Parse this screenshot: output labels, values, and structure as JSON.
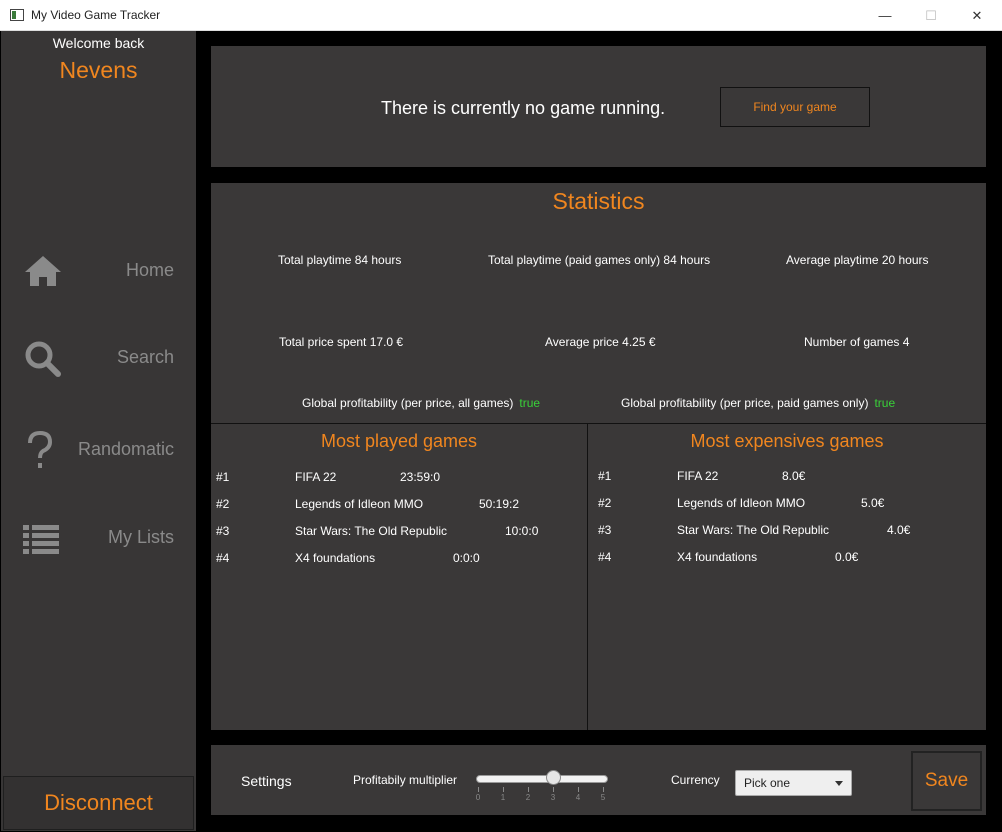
{
  "window": {
    "title": "My Video Game Tracker",
    "minimize_glyph": "—",
    "maximize_glyph": "☐",
    "close_glyph": "✕"
  },
  "sidebar": {
    "welcome": "Welcome back",
    "username": "Nevens",
    "items": [
      {
        "label": "Home",
        "icon": "home-icon"
      },
      {
        "label": "Search",
        "icon": "search-icon"
      },
      {
        "label": "Randomatic",
        "icon": "question-icon"
      },
      {
        "label": "My Lists",
        "icon": "list-icon"
      }
    ],
    "disconnect_label": "Disconnect"
  },
  "running": {
    "message": "There is currently no game running.",
    "find_button": "Find your game"
  },
  "statistics": {
    "title": "Statistics",
    "total_playtime": "Total playtime 84 hours",
    "total_playtime_paid": "Total playtime (paid games only) 84 hours",
    "average_playtime": "Average playtime 20 hours",
    "total_price": "Total price spent 17.0 €",
    "average_price": "Average price 4.25 €",
    "number_of_games": "Number of games 4",
    "global_profit_all_label": "Global profitability (per price, all games)",
    "global_profit_all_value": "true",
    "global_profit_paid_label": "Global profitability (per price, paid games only)",
    "global_profit_paid_value": "true"
  },
  "most_played": {
    "title": "Most played games",
    "rows": [
      {
        "rank": "#1",
        "name": "FIFA 22",
        "value": "23:59:0"
      },
      {
        "rank": "#2",
        "name": "Legends of Idleon MMO",
        "value": "50:19:2"
      },
      {
        "rank": "#3",
        "name": "Star Wars: The Old Republic",
        "value": "10:0:0"
      },
      {
        "rank": "#4",
        "name": "X4 foundations",
        "value": "0:0:0"
      }
    ]
  },
  "most_expensive": {
    "title": "Most expensives games",
    "rows": [
      {
        "rank": "#1",
        "name": "FIFA 22",
        "value": "8.0€"
      },
      {
        "rank": "#2",
        "name": "Legends of Idleon MMO",
        "value": "5.0€"
      },
      {
        "rank": "#3",
        "name": "Star Wars: The Old Republic",
        "value": "4.0€"
      },
      {
        "rank": "#4",
        "name": "X4 foundations",
        "value": "0.0€"
      }
    ]
  },
  "settings": {
    "label": "Settings",
    "multiplier_label": "Profitabily multiplier",
    "multiplier_value": 3,
    "multiplier_min": 0,
    "multiplier_max": 5,
    "tick_labels": [
      "0",
      "1",
      "2",
      "3",
      "4",
      "5"
    ],
    "currency_label": "Currency",
    "currency_value": "Pick one",
    "save_label": "Save"
  },
  "colors": {
    "accent": "#f0861f",
    "positive": "#39d139",
    "panel": "#3a3838",
    "sidebar": "#383636"
  }
}
